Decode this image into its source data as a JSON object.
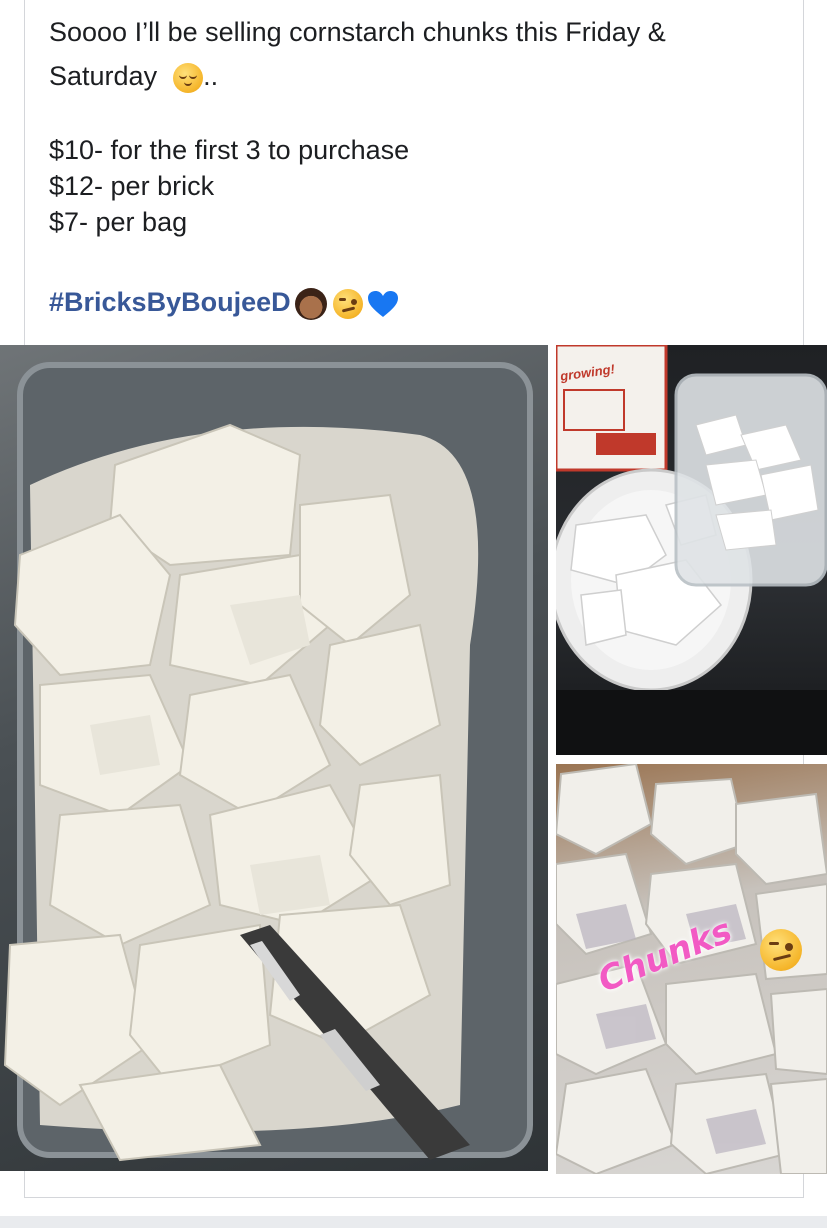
{
  "post": {
    "line1": "Soooo I’ll be selling cornstarch chunks this Friday &",
    "line2": "Saturday",
    "line2_suffix": "..",
    "price_first": "$10- for the first 3 to purchase",
    "price_brick": "$12- per brick",
    "price_bag": "$7- per bag",
    "hashtag": "#BricksByBoujeeD",
    "emoji_after_saturday": "relieved-face-icon",
    "emojis_after_hashtag": [
      "woman-getting-massage-icon",
      "woozy-face-icon",
      "blue-heart-icon"
    ]
  },
  "photos": {
    "top_right_box_text": "growing!",
    "bottom_right_caption": "Chunks",
    "bottom_right_sticker": "woozy-face-icon"
  },
  "colors": {
    "hashtag": "#385898",
    "text": "#1c1e21",
    "caption": "#f25ac4",
    "heart": "#1877f2"
  }
}
